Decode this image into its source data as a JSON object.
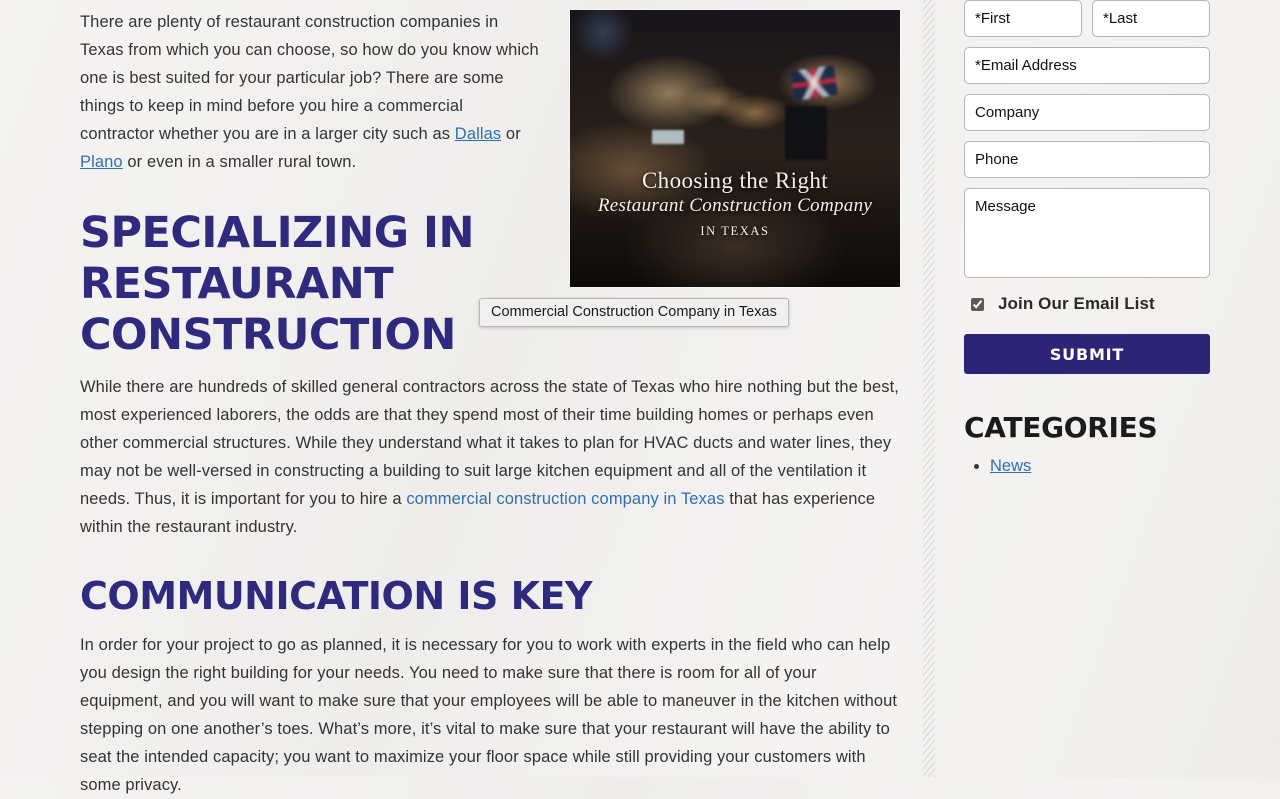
{
  "colors": {
    "heading_indigo": "#2e2a7d",
    "link_blue": "#2f6fad",
    "submit_bg": "#2b2477",
    "body_text": "#333333",
    "page_bg": "#f2f1f0"
  },
  "article": {
    "intro_parts": {
      "before_link1": "There are plenty of restaurant construction companies in Texas from which you can choose, so how do you know which one is best suited for your particular job? There are some things to keep in mind before you hire a commercial contractor whether you are in a larger city such as ",
      "link1": "Dallas",
      "between_links": " or ",
      "link2": "Plano",
      "after_link2": " or even in a smaller rural town."
    },
    "heading_1": "SPECIALIZING IN RESTAURANT CONSTRUCTION",
    "paragraph_2_parts": {
      "before_link": "While there are hundreds of skilled general contractors across the state of Texas who hire nothing but the best, most experienced laborers, the odds are that they spend most of their time building homes or perhaps even other commercial structures. While they understand what it takes to plan for HVAC ducts and water lines, they may not be well-versed in constructing a building to suit large kitchen equipment and all of the ventilation it needs. Thus, it is important for you to hire a ",
      "link": "commercial construction company in Texas",
      "after_link": " that has experience within the restaurant industry."
    },
    "heading_2": "COMMUNICATION IS KEY",
    "paragraph_3": "In order for your project to go as planned, it is necessary for you to work with experts in the field who can help you design the right building for your needs. You need to make sure that there is room for all of your equipment, and you will want to make sure that your employees will be able to maneuver in the kitchen without stepping on one another’s toes. What’s more, it’s vital to make sure that your restaurant will have the ability to seat the intended capacity; you want to maximize your floor space while still providing your customers with some privacy."
  },
  "figure": {
    "overlay_line_1": "Choosing the Right",
    "overlay_line_2": "Restaurant Construction Company",
    "overlay_line_3": "IN TEXAS",
    "alt": "Choosing the Right Restaurant Construction Company in Texas"
  },
  "tooltip": {
    "text": "Commercial Construction Company in Texas"
  },
  "sidebar": {
    "form": {
      "first_name_placeholder": "*First",
      "first_name_value": "",
      "last_name_placeholder": "*Last",
      "last_name_value": "",
      "email_placeholder": "*Email Address",
      "email_value": "",
      "company_placeholder": "Company",
      "company_value": "",
      "phone_placeholder": "Phone",
      "phone_value": "",
      "message_placeholder": "Message",
      "message_value": "",
      "opt_in_label": "Join Our Email List",
      "opt_in_checked": true,
      "submit_label": "SUBMIT"
    },
    "categories": {
      "heading": "CATEGORIES",
      "items": [
        {
          "label": "News"
        }
      ]
    }
  }
}
